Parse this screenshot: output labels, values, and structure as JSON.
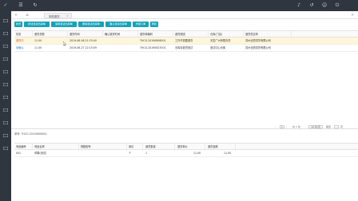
{
  "colors": {
    "sidebar": "#2f3640",
    "button": "#17a2b8",
    "link": "#2f76c8",
    "status_red": "#d9534f",
    "selected_row": "#fff6d9"
  },
  "sidebar": {
    "logo_icon": "logo-check-icon",
    "nav_icons": [
      "home-icon",
      "list-icon",
      "setting-icon",
      "list-icon",
      "cart-icon",
      "box-icon",
      "chart-icon",
      "doc-icon",
      "chart-icon",
      "trend-icon",
      "chart-icon"
    ]
  },
  "topbar": {
    "icons": [
      "menu-icon",
      "refresh-icon",
      "bell-icon",
      "undo-icon",
      "user-icon",
      "power-icon"
    ]
  },
  "tabs": {
    "items": [
      {
        "label": "采购退货",
        "close": "×"
      }
    ]
  },
  "toolbar": {
    "buttons": [
      "新增",
      "新建退货出库单",
      "编辑退货出库单",
      "删除退货出库单",
      "确认退货出库单",
      "作废订单",
      "刷新"
    ]
  },
  "main_table": {
    "columns": [
      "状态",
      "退货总额",
      "退货时间",
      "确认退货时间",
      "退货单编码",
      "退货原因",
      "仓库(门店)",
      "退货供应商"
    ],
    "rows": [
      [
        "退货中",
        "11.00",
        "2019-08-06 21:33:40",
        "",
        "THCG-20190806001",
        "工作不需要退货",
        "天堂广州有限责任",
        "苏州优质供货有限公司"
      ],
      [
        "待确认",
        "11.00",
        "2019-06-27 22:15:09",
        "",
        "THCG-20190627001",
        "去库存退货测试",
        "测试中心仓库",
        "苏州优质供货有限公司"
      ]
    ]
  },
  "pager": {
    "prev": "‹",
    "page": "1",
    "next": "›",
    "total": "共 1 条",
    "size": "10 条/页",
    "jump": "跳至",
    "unit": "页"
  },
  "detail": {
    "title": "单号: THCG-20190806001",
    "columns": [
      "商品编号",
      "商品名称",
      "规格型号",
      "单位",
      "退货数量",
      "退货单价",
      "退货金额"
    ],
    "rows": [
      [
        "001",
        "苹果(测试)",
        "",
        "个",
        "1",
        "11.00",
        "11.00"
      ]
    ]
  }
}
